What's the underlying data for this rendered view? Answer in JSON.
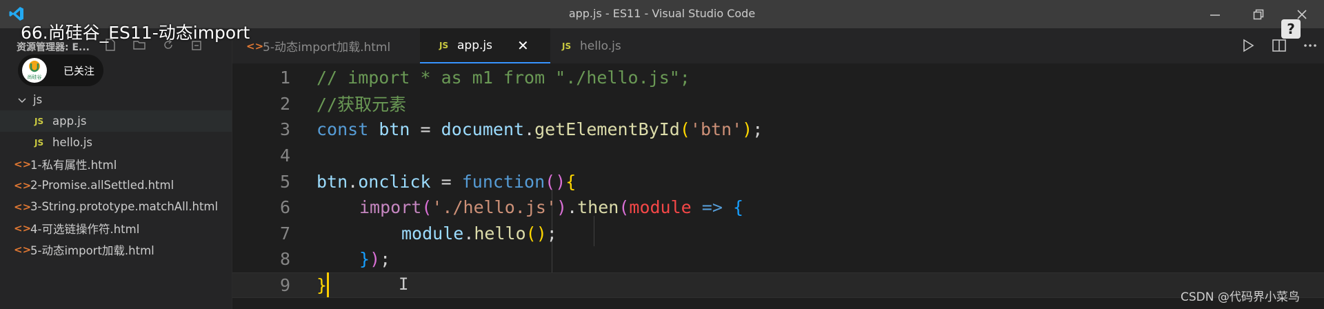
{
  "window": {
    "title": "app.js - ES11 - Visual Studio Code"
  },
  "video_overlay": {
    "title": "66.尚硅谷_ES11-动态import",
    "follow_label": "已关注",
    "avatar_text": "尚硅谷"
  },
  "help_badge": "?",
  "sidebar": {
    "header": "资源管理器: E...",
    "items": [
      {
        "label": "js",
        "kind": "folder"
      },
      {
        "label": "app.js",
        "kind": "js",
        "selected": true
      },
      {
        "label": "hello.js",
        "kind": "js"
      },
      {
        "label": "1-私有属性.html",
        "kind": "html"
      },
      {
        "label": "2-Promise.allSettled.html",
        "kind": "html"
      },
      {
        "label": "3-String.prototype.matchAll.html",
        "kind": "html"
      },
      {
        "label": "4-可选链操作符.html",
        "kind": "html"
      },
      {
        "label": "5-动态import加载.html",
        "kind": "html"
      }
    ]
  },
  "tabs": [
    {
      "label": "5-动态import加载.html",
      "icon": "html-icon",
      "active": false
    },
    {
      "label": "app.js",
      "icon": "js-icon",
      "active": true,
      "close": "✕"
    },
    {
      "label": "hello.js",
      "icon": "js-icon",
      "active": false
    }
  ],
  "js_badge": "JS",
  "editor": {
    "line_numbers": [
      "1",
      "2",
      "3",
      "4",
      "5",
      "6",
      "7",
      "8",
      "9"
    ],
    "current_line": 9,
    "code": {
      "l1": "// import * as m1 from \"./hello.js\";",
      "l2": "//获取元素",
      "l3_kw": "const",
      "l3_var": "btn",
      "l3_eq": " = ",
      "l3_doc": "document",
      "l3_dot": ".",
      "l3_fn": "getElementById",
      "l3_open": "(",
      "l3_str": "'btn'",
      "l3_close": ")",
      "l3_semi": ";",
      "l5_var": "btn",
      "l5_dot": ".",
      "l5_prop": "onclick",
      "l5_eq": " = ",
      "l5_kw": "function",
      "l5_parens": "()",
      "l5_brace": "{",
      "l6_imp": "import",
      "l6_open": "(",
      "l6_str": "'./hello.js'",
      "l6_close": ")",
      "l6_dot": ".",
      "l6_then": "then",
      "l6_open2": "(",
      "l6_param": "module",
      "l6_arrow": " => ",
      "l6_brace": "{",
      "l7_var": "module",
      "l7_dot": ".",
      "l7_fn": "hello",
      "l7_call": "()",
      "l7_semi": ";",
      "l8_brace": "}",
      "l8_paren": ")",
      "l8_semi": ";",
      "l9_brace": "}"
    }
  },
  "watermark": "CSDN @代码界小菜鸟",
  "colors": {
    "editor_bg": "#1e1e1e",
    "sidebar_bg": "#252526",
    "titlebar_bg": "#3c3c3c",
    "active_tab_border": "#3794ff",
    "cursor": "#ffcc00"
  }
}
